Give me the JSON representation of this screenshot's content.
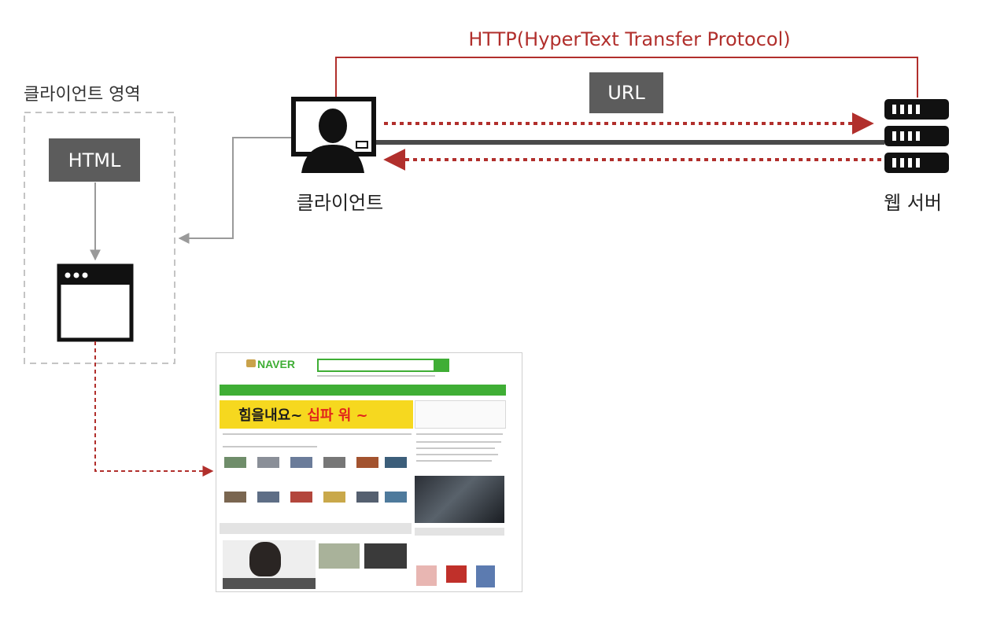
{
  "labels": {
    "http": "HTTP(HyperText Transfer Protocol)",
    "client_area": "클라이언트 영역",
    "url": "URL",
    "html": "HTML",
    "client": "클라이언트",
    "web_server": "웹 서버"
  },
  "screenshot": {
    "logo": "NAVER",
    "banner_left": "힘을내요~",
    "banner_right": "십파 워 ~"
  },
  "colors": {
    "http_red": "#b12f2c",
    "arrow_red": "#b12f2c",
    "tag_gray": "#5c5c5c",
    "naver_green": "#3fae35"
  },
  "icons": {
    "client": "user-monitor-icon",
    "server": "server-rack-icon",
    "browser": "browser-window-icon"
  }
}
